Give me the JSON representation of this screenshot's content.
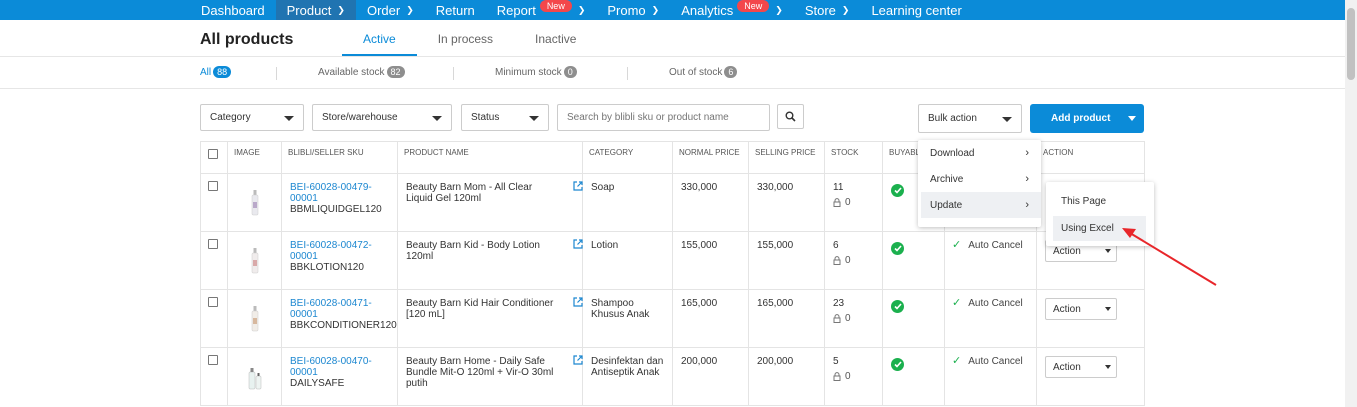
{
  "nav": {
    "items": [
      {
        "label": "Dashboard",
        "chevron": false,
        "badge": ""
      },
      {
        "label": "Product",
        "chevron": true,
        "badge": ""
      },
      {
        "label": "Order",
        "chevron": true,
        "badge": ""
      },
      {
        "label": "Return",
        "chevron": false,
        "badge": ""
      },
      {
        "label": "Report",
        "chevron": true,
        "badge": "New"
      },
      {
        "label": "Promo",
        "chevron": true,
        "badge": ""
      },
      {
        "label": "Analytics",
        "chevron": true,
        "badge": "New"
      },
      {
        "label": "Store",
        "chevron": true,
        "badge": ""
      },
      {
        "label": "Learning center",
        "chevron": false,
        "badge": ""
      }
    ],
    "active": "Product"
  },
  "page": {
    "title": "All products",
    "tabs": [
      "Active",
      "In process",
      "Inactive"
    ],
    "active_tab": "Active"
  },
  "filters": {
    "all_label": "All",
    "all_count": "88",
    "available_label": "Available stock",
    "available_count": "82",
    "minimum_label": "Minimum stock",
    "minimum_count": "0",
    "out_label": "Out of stock",
    "out_count": "6"
  },
  "toolbar": {
    "category": "Category",
    "store": "Store/warehouse",
    "status": "Status",
    "search_placeholder": "Search by blibli sku or product name",
    "bulk_action": "Bulk action",
    "add_product": "Add product"
  },
  "table": {
    "headers": {
      "image": "IMAGE",
      "sku": "BLIBLI/SELLER SKU",
      "name": "PRODUCT NAME",
      "category": "CATEGORY",
      "normal_price": "NORMAL PRICE",
      "selling_price": "SELLING PRICE",
      "stock": "STOCK",
      "buyable": "BUYABLE",
      "action": "ACTION"
    },
    "rows": [
      {
        "sku": "BEI-60028-00479-00001",
        "seller_sku": "BBMLIQUIDGEL120",
        "name": "Beauty Barn Mom - All Clear Liquid Gel 120ml",
        "category": "Soap",
        "normal_price": "330,000",
        "selling_price": "330,000",
        "stock": "11",
        "locked": "0",
        "auto_cancel": "",
        "action": ""
      },
      {
        "sku": "BEI-60028-00472-00001",
        "seller_sku": "BBKLOTION120",
        "name": "Beauty Barn Kid - Body Lotion 120ml",
        "category": "Lotion",
        "normal_price": "155,000",
        "selling_price": "155,000",
        "stock": "6",
        "locked": "0",
        "auto_cancel": "Auto Cancel",
        "action": "Action"
      },
      {
        "sku": "BEI-60028-00471-00001",
        "seller_sku": "BBKCONDITIONER120",
        "name": "Beauty Barn Kid Hair Conditioner [120 mL]",
        "category": "Shampoo Khusus Anak",
        "normal_price": "165,000",
        "selling_price": "165,000",
        "stock": "23",
        "locked": "0",
        "auto_cancel": "Auto Cancel",
        "action": "Action"
      },
      {
        "sku": "BEI-60028-00470-00001",
        "seller_sku": "DAILYSAFE",
        "name": "Beauty Barn Home - Daily Safe Bundle Mit-O 120ml + Vir-O 30ml putih",
        "category": "Desinfektan dan Antiseptik Anak",
        "normal_price": "200,000",
        "selling_price": "200,000",
        "stock": "5",
        "locked": "0",
        "auto_cancel": "Auto Cancel",
        "action": "Action"
      }
    ]
  },
  "bulk_menu": {
    "items": [
      "Download",
      "Archive",
      "Update"
    ],
    "highlighted": "Update",
    "submenu": [
      "This Page",
      "Using Excel"
    ],
    "sub_highlighted": "Using Excel"
  },
  "colors": {
    "nav_bg": "#0b8bd8",
    "nav_active": "#2074b1",
    "badge_new": "#f3474b",
    "link": "#1c87d0",
    "success": "#1bb04e",
    "annotation_arrow": "#e8262a"
  }
}
